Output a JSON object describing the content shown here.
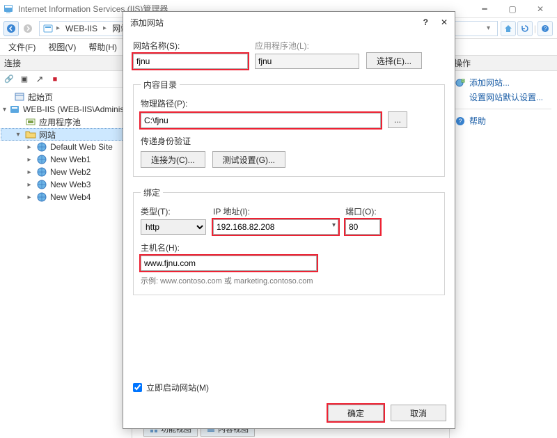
{
  "window": {
    "title": "Internet Information Services (IIS)管理器",
    "color_accent": "#1a5da6",
    "color_highlight_red": "#e23"
  },
  "address": {
    "crumbs": [
      "WEB-IIS",
      "网站"
    ],
    "back_enabled": true,
    "forward_enabled": false
  },
  "menubar": [
    "文件(F)",
    "视图(V)",
    "帮助(H)"
  ],
  "left_panel": {
    "header": "连接",
    "toolbar_icons": [
      "link-reconnect-icon",
      "expand-icon",
      "collapse-icon",
      "stop-icon"
    ],
    "tree": {
      "start_page": "起始页",
      "server": "WEB-IIS (WEB-IIS\\Administrat",
      "app_pools": "应用程序池",
      "sites_node": "网站",
      "sites": [
        "Default Web Site",
        "New Web1",
        "New Web2",
        "New Web3",
        "New Web4"
      ]
    }
  },
  "right_panel": {
    "header": "操作",
    "actions": {
      "add_site": "添加网站...",
      "set_defaults": "设置网站默认设置...",
      "help": "帮助"
    }
  },
  "dialog": {
    "title": "添加网站",
    "labels": {
      "site_name": "网站名称(S):",
      "app_pool": "应用程序池(L):",
      "select_btn": "选择(E)...",
      "content_dir": "内容目录",
      "physical_path": "物理路径(P):",
      "browse_btn": "...",
      "passthrough": "传递身份验证",
      "connect_as": "连接为(C)...",
      "test_settings": "测试设置(G)...",
      "binding": "绑定",
      "type": "类型(T):",
      "ip": "IP 地址(I):",
      "port": "端口(O):",
      "host": "主机名(H):",
      "example": "示例: www.contoso.com 或 marketing.contoso.com",
      "start_immediately": "立即启动网站(M)",
      "ok": "确定",
      "cancel": "取消"
    },
    "values": {
      "site_name": "fjnu",
      "app_pool": "fjnu",
      "physical_path": "C:\\fjnu",
      "type": "http",
      "ip": "192.168.82.208",
      "port": "80",
      "host": "www.fjnu.com",
      "start_immediately_checked": true
    }
  },
  "bottom_tabs": {
    "features": "功能视图",
    "content": "内容视图"
  }
}
